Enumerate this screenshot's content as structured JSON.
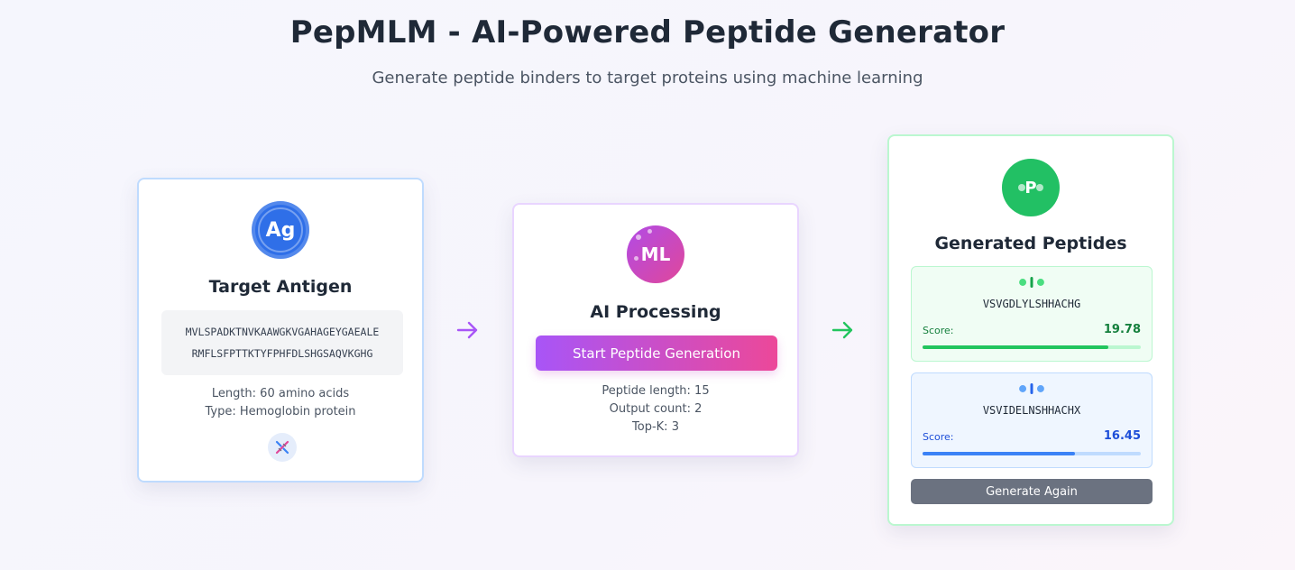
{
  "header": {
    "title": "PepMLM - AI-Powered Peptide Generator",
    "subtitle": "Generate peptide binders to target proteins using machine learning"
  },
  "antigen": {
    "badge": "Ag",
    "title": "Target Antigen",
    "sequence_line1": "MVLSPADKTNVKAAWGKVGAHAGEYGAEALE",
    "sequence_line2": "RMFLSFPTTKTYFPHFDLSHGSAQVKGHG",
    "length": "Length: 60 amino acids",
    "type": "Type: Hemoglobin protein",
    "icon": "dna-icon"
  },
  "processing": {
    "badge": "ML",
    "title": "AI Processing",
    "start_button": "Start Peptide Generation",
    "peptide_length": "Peptide length: 15",
    "output_count": "Output count: 2",
    "top_k": "Top-K: 3"
  },
  "output": {
    "badge": "P",
    "title": "Generated Peptides",
    "score_label": "Score:",
    "peptides": [
      {
        "sequence": "VSVGDLYLSHHACHG",
        "score": "19.78",
        "score_fraction": 0.85
      },
      {
        "sequence": "VSVIDELNSHHACHX",
        "score": "16.45",
        "score_fraction": 0.7
      }
    ],
    "again_button": "Generate Again"
  },
  "colors": {
    "antigen_accent": "#2f6fe8",
    "processing_accent_start": "#a855f7",
    "processing_accent_end": "#ec4899",
    "output_accent": "#22c064",
    "arrow_purple": "#a855f7",
    "arrow_green": "#22c55e"
  }
}
